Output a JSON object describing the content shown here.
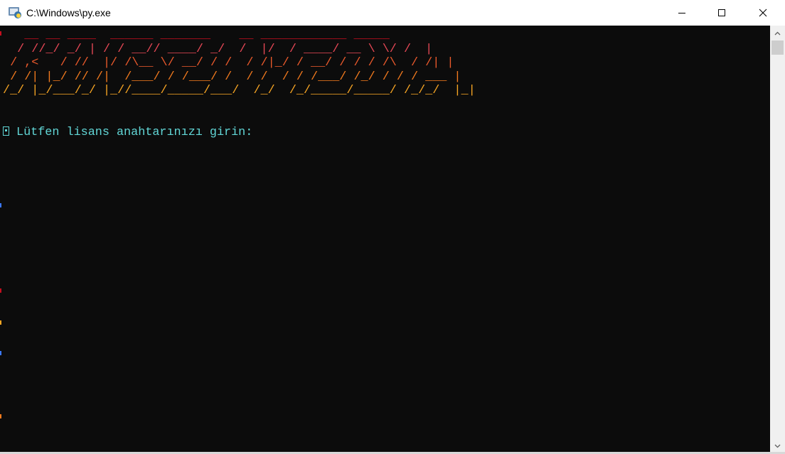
{
  "window": {
    "title": "C:\\Windows\\py.exe",
    "controls": {
      "minimize": "minimize-icon",
      "maximize": "maximize-icon",
      "close": "close-icon"
    }
  },
  "banner": {
    "lines": [
      "   __ __ ____  ______ _______    __ ____________ _____",
      "  / //_/ _/ | / / __// ____/ _/  /  |/  / ____/ __ \\ \\/ /  |",
      " / ,<   / //  |/ /\\__ \\/ __/ / /  / /|_/ / __/ / / / /\\  / /| |",
      " / /| |_/ // /|  /___/ / /___/ /  / /  / / /___/ /_/ / / / ___ |",
      "/_/ |_/___/_/ |_//____/_____/___/  /_/  /_/_____/_____/ /_/_/  |_|"
    ],
    "colors": [
      "#c50f1f",
      "#e74856",
      "#ec5a2c",
      "#f27a1e",
      "#f7a523"
    ]
  },
  "prompt": {
    "icon": "key-icon",
    "text": "Lütfen lisans anahtarınızı girin:"
  },
  "colors": {
    "console_bg": "#0c0c0c",
    "prompt_text": "#61d6d6"
  }
}
